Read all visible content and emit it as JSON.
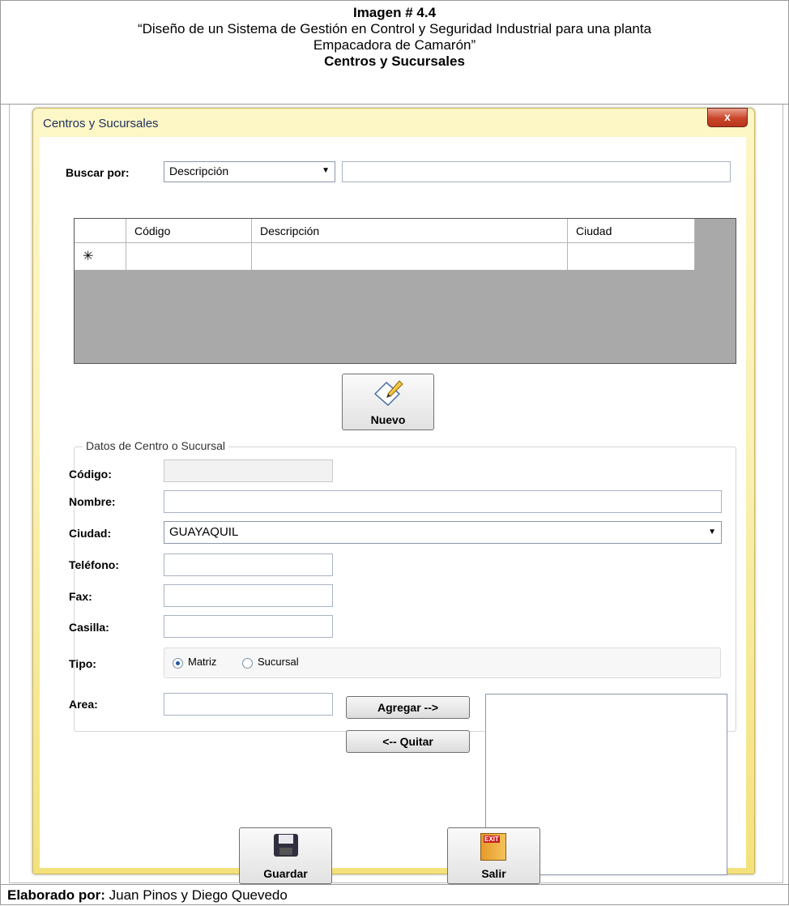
{
  "caption": {
    "figure_label": "Imagen # 4.4",
    "description_line1": "“Diseño de un Sistema de Gestión en Control y Seguridad Industrial para una planta",
    "description_line2": "Empacadora de Camarón”",
    "subtitle": "Centros y Sucursales"
  },
  "footer": {
    "label": "Elaborado por:",
    "authors": "Juan Pinos y Diego Quevedo"
  },
  "window": {
    "title": "Centros y Sucursales",
    "close_glyph": "x"
  },
  "search": {
    "label": "Buscar por:",
    "field_selected": "Descripción",
    "value": ""
  },
  "grid": {
    "columns": [
      "Código",
      "Descripción",
      "Ciudad"
    ],
    "new_row_marker": "✳"
  },
  "buttons": {
    "nuevo": "Nuevo",
    "agregar": "Agregar -->",
    "quitar": "<-- Quitar",
    "guardar": "Guardar",
    "salir": "Salir",
    "exit_sign": "EXIT"
  },
  "form": {
    "group_title": "Datos de Centro o Sucursal",
    "codigo_label": "Código:",
    "codigo_value": "",
    "nombre_label": "Nombre:",
    "nombre_value": "",
    "ciudad_label": "Ciudad:",
    "ciudad_value": "GUAYAQUIL",
    "telefono_label": "Teléfono:",
    "fax_label": "Fax:",
    "casilla_label": "Casilla:",
    "tipo_label": "Tipo:",
    "tipo_options": [
      "Matriz",
      "Sucursal"
    ],
    "tipo_selected": "Matriz",
    "area_label": "Area:"
  },
  "colors": {
    "window_gradient_top": "#fdf6c6",
    "window_gradient_bottom": "#f3e27b",
    "close_button": "#c9452a",
    "grid_background": "#a9a9a9"
  }
}
